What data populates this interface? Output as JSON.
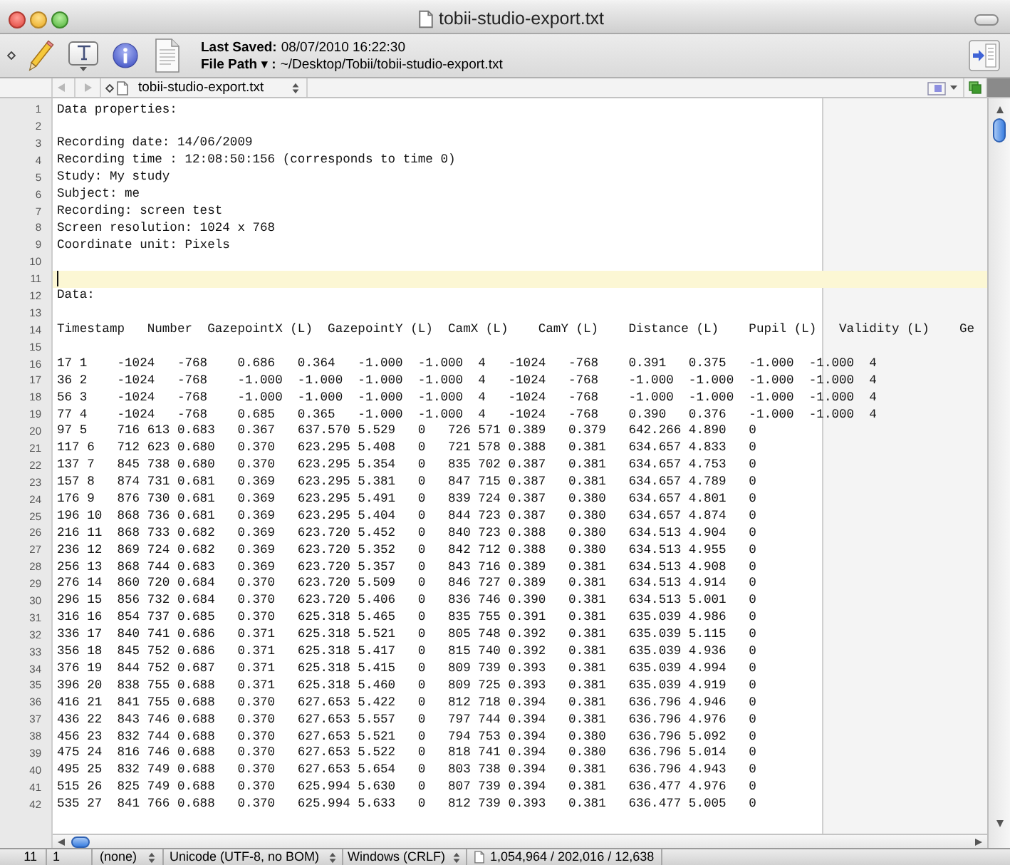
{
  "window": {
    "title": "tobii-studio-export.txt"
  },
  "toolbar": {
    "last_saved_label": "Last Saved:",
    "last_saved": "08/07/2010 16:22:30",
    "file_path_label": "File Path ▾ :",
    "file_path": "~/Desktop/Tobii/tobii-studio-export.txt"
  },
  "navigation_bar": {
    "back": {
      "disabled": true
    },
    "forward": {
      "disabled": true
    },
    "document": "tobii-studio-export.txt"
  },
  "editor": {
    "lines": [
      {
        "number": "1",
        "text": "Data properties:",
        "current": false
      },
      {
        "number": "2",
        "current": false
      },
      {
        "number": "3",
        "text": "Recording date: 14/06/2009",
        "current": false
      },
      {
        "number": "4",
        "text": "Recording time : 12:08:50:156 (corresponds to time 0)",
        "current": false
      },
      {
        "number": "5",
        "text": "Study: My study",
        "current": false
      },
      {
        "number": "6",
        "text": "Subject: me",
        "current": false
      },
      {
        "number": "7",
        "text": "Recording: screen test",
        "current": false
      },
      {
        "number": "8",
        "text": "Screen resolution: 1024 x 768",
        "current": false
      },
      {
        "number": "9",
        "text": "Coordinate unit: Pixels",
        "current": false
      },
      {
        "number": "10",
        "current": false
      },
      {
        "number": "11",
        "current": true
      },
      {
        "number": "12",
        "text": "Data:",
        "current": false
      },
      {
        "number": "13",
        "current": false
      },
      {
        "number": "14",
        "text": "Timestamp   Number  GazepointX (L)  GazepointY (L)  CamX (L)    CamY (L)    Distance (L)    Pupil (L)   Validity (L)    Ge",
        "current": false
      },
      {
        "number": "15",
        "current": false
      },
      {
        "number": "16",
        "text": "17 1    -1024   -768    0.686   0.364   -1.000  -1.000  4   -1024   -768    0.391   0.375   -1.000  -1.000  4",
        "current": false
      },
      {
        "number": "17",
        "text": "36 2    -1024   -768    -1.000  -1.000  -1.000  -1.000  4   -1024   -768    -1.000  -1.000  -1.000  -1.000  4",
        "current": false
      },
      {
        "number": "18",
        "text": "56 3    -1024   -768    -1.000  -1.000  -1.000  -1.000  4   -1024   -768    -1.000  -1.000  -1.000  -1.000  4",
        "current": false
      },
      {
        "number": "19",
        "text": "77 4    -1024   -768    0.685   0.365   -1.000  -1.000  4   -1024   -768    0.390   0.376   -1.000  -1.000  4",
        "current": false
      },
      {
        "number": "20",
        "text": "97 5    716 613 0.683   0.367   637.570 5.529   0   726 571 0.389   0.379   642.266 4.890   0",
        "current": false
      },
      {
        "number": "21",
        "text": "117 6   712 623 0.680   0.370   623.295 5.408   0   721 578 0.388   0.381   634.657 4.833   0",
        "current": false
      },
      {
        "number": "22",
        "text": "137 7   845 738 0.680   0.370   623.295 5.354   0   835 702 0.387   0.381   634.657 4.753   0",
        "current": false
      },
      {
        "number": "23",
        "text": "157 8   874 731 0.681   0.369   623.295 5.381   0   847 715 0.387   0.381   634.657 4.789   0",
        "current": false
      },
      {
        "number": "24",
        "text": "176 9   876 730 0.681   0.369   623.295 5.491   0   839 724 0.387   0.380   634.657 4.801   0",
        "current": false
      },
      {
        "number": "25",
        "text": "196 10  868 736 0.681   0.369   623.295 5.404   0   844 723 0.387   0.380   634.657 4.874   0",
        "current": false
      },
      {
        "number": "26",
        "text": "216 11  868 733 0.682   0.369   623.720 5.452   0   840 723 0.388   0.380   634.513 4.904   0",
        "current": false
      },
      {
        "number": "27",
        "text": "236 12  869 724 0.682   0.369   623.720 5.352   0   842 712 0.388   0.380   634.513 4.955   0",
        "current": false
      },
      {
        "number": "28",
        "text": "256 13  868 744 0.683   0.369   623.720 5.357   0   843 716 0.389   0.381   634.513 4.908   0",
        "current": false
      },
      {
        "number": "29",
        "text": "276 14  860 720 0.684   0.370   623.720 5.509   0   846 727 0.389   0.381   634.513 4.914   0",
        "current": false
      },
      {
        "number": "30",
        "text": "296 15  856 732 0.684   0.370   623.720 5.406   0   836 746 0.390   0.381   634.513 5.001   0",
        "current": false
      },
      {
        "number": "31",
        "text": "316 16  854 737 0.685   0.370   625.318 5.465   0   835 755 0.391   0.381   635.039 4.986   0",
        "current": false
      },
      {
        "number": "32",
        "text": "336 17  840 741 0.686   0.371   625.318 5.521   0   805 748 0.392   0.381   635.039 5.115   0",
        "current": false
      },
      {
        "number": "33",
        "text": "356 18  845 752 0.686   0.371   625.318 5.417   0   815 740 0.392   0.381   635.039 4.936   0",
        "current": false
      },
      {
        "number": "34",
        "text": "376 19  844 752 0.687   0.371   625.318 5.415   0   809 739 0.393   0.381   635.039 4.994   0",
        "current": false
      },
      {
        "number": "35",
        "text": "396 20  838 755 0.688   0.371   625.318 5.460   0   809 725 0.393   0.381   635.039 4.919   0",
        "current": false
      },
      {
        "number": "36",
        "text": "416 21  841 755 0.688   0.370   627.653 5.422   0   812 718 0.394   0.381   636.796 4.946   0",
        "current": false
      },
      {
        "number": "37",
        "text": "436 22  843 746 0.688   0.370   627.653 5.557   0   797 744 0.394   0.381   636.796 4.976   0",
        "current": false
      },
      {
        "number": "38",
        "text": "456 23  832 744 0.688   0.370   627.653 5.521   0   794 753 0.394   0.380   636.796 5.092   0",
        "current": false
      },
      {
        "number": "39",
        "text": "475 24  816 746 0.688   0.370   627.653 5.522   0   818 741 0.394   0.380   636.796 5.014   0",
        "current": false
      },
      {
        "number": "40",
        "text": "495 25  832 749 0.688   0.370   627.653 5.654   0   803 738 0.394   0.381   636.796 4.943   0",
        "current": false
      },
      {
        "number": "41",
        "text": "515 26  825 749 0.688   0.370   625.994 5.630   0   807 739 0.394   0.381   636.477 4.976   0",
        "current": false
      },
      {
        "number": "42",
        "text": "535 27  841 766 0.688   0.370   625.994 5.633   0   812 739 0.393   0.381   636.477 5.005   0",
        "current": false
      }
    ]
  },
  "status_bar": {
    "line": "11",
    "column": "1",
    "language": "(none)",
    "encoding": "Unicode (UTF-8, no BOM)",
    "line_endings": "Windows (CRLF)",
    "counts": "1,054,964 / 202,016 / 12,638"
  }
}
